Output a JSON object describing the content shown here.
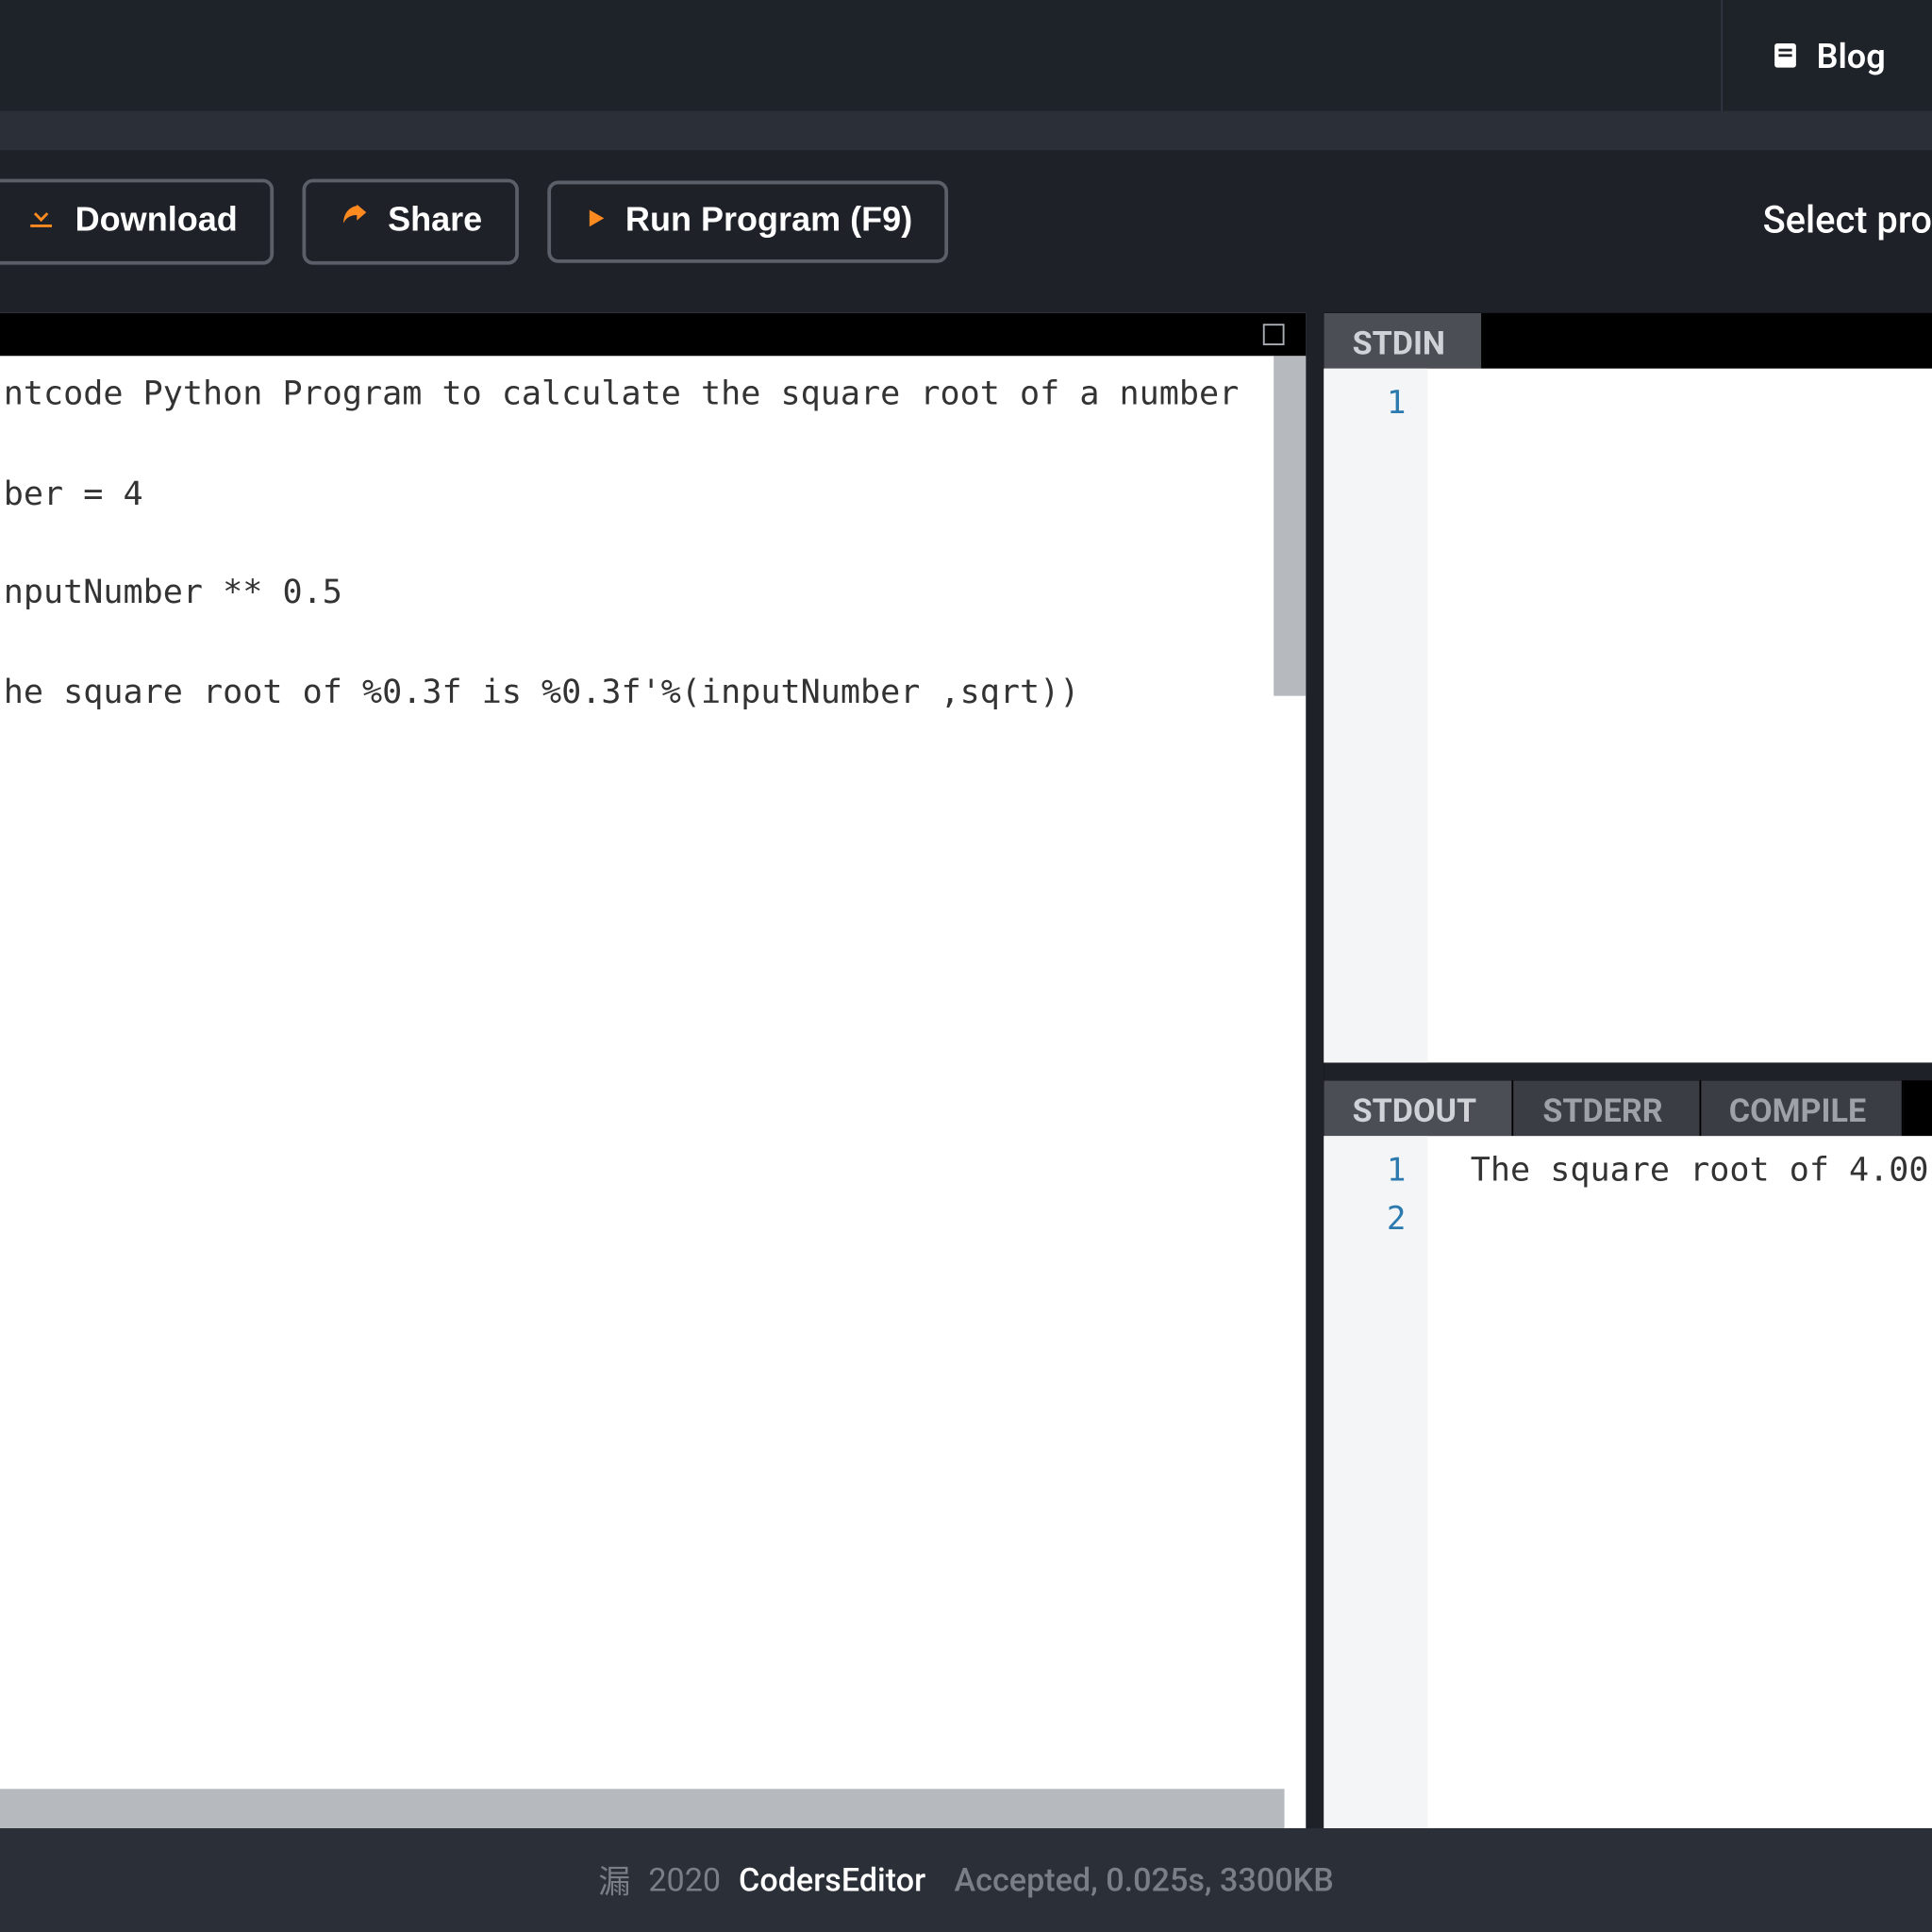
{
  "nav": {
    "blog_label": "Blog"
  },
  "toolbar": {
    "download_label": "Download",
    "share_label": "Share",
    "run_label": "Run Program (F9)",
    "right_text": "Select pro"
  },
  "editor": {
    "lines": [
      "ntcode Python Program to calculate the square root of a number",
      "",
      "ber = 4",
      "",
      "nputNumber ** 0.5",
      "",
      "he square root of %0.3f is %0.3f'%(inputNumber ,sqrt))"
    ]
  },
  "stdin": {
    "tab_label": "STDIN",
    "gutter": [
      "1"
    ],
    "text": ""
  },
  "output": {
    "tabs": {
      "stdout": "STDOUT",
      "stderr": "STDERR",
      "compile": "COMPILE"
    },
    "active_tab": "stdout",
    "gutter": [
      "1",
      "2"
    ],
    "lines": [
      "The square root of 4.00",
      ""
    ]
  },
  "footer": {
    "copyright_symbol": "漏",
    "year": "2020",
    "brand": "CodersEditor",
    "status": "Accepted, 0.025s, 3300KB"
  }
}
